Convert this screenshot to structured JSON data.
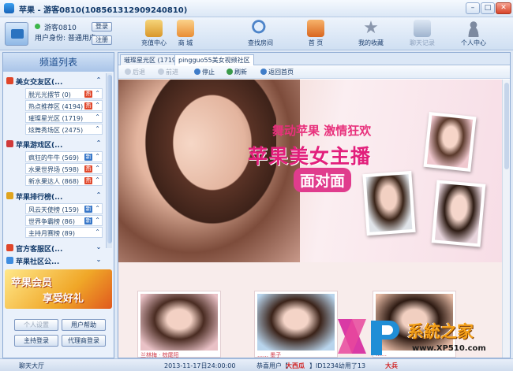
{
  "window": {
    "title": "苹果 - 游客0810(108561312909240810)",
    "minimize_glyph": "–",
    "restore_glyph": "□",
    "close_glyph": "✕"
  },
  "user": {
    "name": "游客0810",
    "role": "用户身份: 普通用户",
    "login_label": "登录",
    "register_label": "注册"
  },
  "toolbar": {
    "items": [
      {
        "label": "充值中心",
        "icon": "wallet-icon",
        "color": "#e9b94b"
      },
      {
        "label": "商 城",
        "icon": "cart-icon",
        "color": "#f0a24a"
      },
      {
        "label": "查找房间",
        "icon": "search-icon",
        "color": "#5b8fcf"
      },
      {
        "label": "首 页",
        "icon": "home-icon",
        "color": "#e8873a"
      },
      {
        "label": "我的收藏",
        "icon": "star-icon",
        "color": "#8a97ad"
      },
      {
        "label": "聊天记录",
        "icon": "chat-log-icon",
        "color": "#9fb4cf"
      },
      {
        "label": "个人中心",
        "icon": "person-icon",
        "color": "#7d8aa0"
      }
    ]
  },
  "sidebar": {
    "title": "频道列表",
    "categories": [
      {
        "label": "美女交友区(...",
        "icon_color": "#e0462a",
        "items": [
          {
            "label": "脱光光摆节 (0)",
            "tag": "热"
          },
          {
            "label": "热点推荐区 (4194)",
            "tag": "热"
          },
          {
            "label": "璀璨星光区 (1719)",
            "tag": ""
          },
          {
            "label": "炫舞秀场区 (2475)",
            "tag": ""
          }
        ]
      },
      {
        "label": "苹果游戏区(...",
        "icon_color": "#d03a3a",
        "items": [
          {
            "label": "疯狂的牛牛 (569)",
            "tag": "新"
          },
          {
            "label": "水果世界场 (598)",
            "tag": "热"
          },
          {
            "label": "新水果达人 (868)",
            "tag": "热"
          }
        ]
      },
      {
        "label": "苹果排行榜(...",
        "icon_color": "#e0a41e",
        "items": [
          {
            "label": "风云天使榜 (159)",
            "tag": "新"
          },
          {
            "label": "世界争霸榜 (86)",
            "tag": "新"
          },
          {
            "label": "主持月赛榜 (89)",
            "tag": ""
          }
        ]
      },
      {
        "label": "官方客服区(...",
        "icon_color": "#e0462a",
        "items": []
      },
      {
        "label": "苹果社区公...",
        "icon_color": "#3f8de0",
        "items": []
      }
    ],
    "promo": {
      "line1": "苹果会员",
      "line2": "享受好礼"
    },
    "buttons": {
      "personal_settings": "个人设置",
      "user_help": "用户帮助",
      "host_login": "主持登录",
      "agent_login": "代理商登录"
    }
  },
  "main": {
    "tabs": [
      {
        "label": "璀璨星光区 (1719)",
        "active": false
      },
      {
        "label": "pingguo55美女视频社区",
        "active": true
      }
    ],
    "nav": {
      "back": "后退",
      "forward": "前进",
      "stop": "停止",
      "refresh": "刷新",
      "home": "返回首页"
    },
    "banner": {
      "subtitle": "舞动苹果 激情狂欢",
      "title": "苹果美女主播",
      "face": "面对面"
    },
    "gallery": [
      {
        "caption": "兰林梅 · 棕尾阳"
      },
      {
        "caption": "…… 墨子"
      },
      {
        "caption": "……"
      }
    ]
  },
  "statusbar": {
    "lobby": "聊天大厅",
    "notice_prefix": "2013-11-17日24:00:00",
    "notice_mid": "恭喜用户【",
    "notice_user": "大西瓜",
    "notice_end": "】ID1234幼用了13",
    "notice_tail": "大兵"
  },
  "watermark": {
    "brand": "系統之家",
    "url": "www.XP510.com"
  }
}
